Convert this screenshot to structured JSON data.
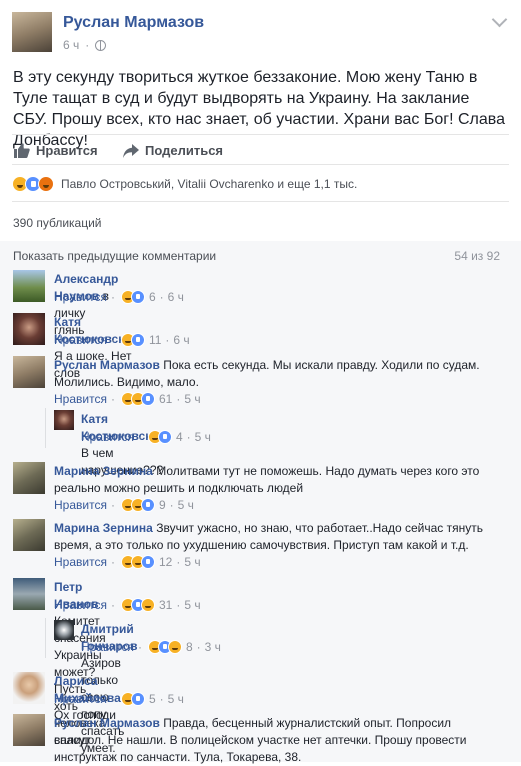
{
  "post": {
    "author": "Руслан Мармазов",
    "time": "6 ч",
    "text": "В эту секунду твориться жуткое беззаконие. Мою жену Таню в Туле тащат в суд и будут выдворять на Украину. На заклание СБУ. Прошу всех, кто нас знает, об участии. Храни вас Бог! Слава Донбассу!",
    "actions": {
      "like": "Нравится",
      "share": "Поделиться"
    },
    "reactions_text": "Павло Островський, Vitalii Ovcharenko и еще 1,1 тыс.",
    "shares": "390 публикаций"
  },
  "comments_header": {
    "prev_label": "Показать предыдущие комментарии",
    "count": "54 из 92"
  },
  "comments": [
    {
      "name": "Александр Наумов",
      "text": "в личку глянь",
      "like": "Нравится",
      "count": "6",
      "time": "6 ч"
    },
    {
      "name": "Катя Костюковская",
      "text": "Я а шоке. Нет слов",
      "like": "Нравится",
      "count": "11",
      "time": "6 ч"
    },
    {
      "name": "Руслан Мармазов",
      "text": "Пока есть секунда. Мы искали правду. Ходили по судам.",
      "text2": "Молились. Видимо, мало.",
      "like": "Нравится",
      "count": "61",
      "time": "5 ч"
    },
    {
      "name": "Катя Костюковская",
      "text": "В чем нарушение???",
      "like": "Нравится",
      "count": "4",
      "time": "5 ч"
    },
    {
      "name": "Марина Зернина",
      "text": "Молитвами тут не поможешь. Надо думать через кого это",
      "text2": "реально можно решить и подключать людей",
      "like": "Нравится",
      "count": "9",
      "time": "5 ч"
    },
    {
      "name": "Марина Зернина",
      "text": "Звучит ужасно, но знаю, что работает..Надо сейчас тянуть",
      "text2": "время, а это только по ухудшению самочувствия. Приступ там какой и т.д.",
      "like": "Нравится",
      "count": "12",
      "time": "5 ч"
    },
    {
      "name": "Петр Иванов",
      "text": "Комитет спасения Украины может? Пусть хоть человека спасут",
      "like": "Нравится",
      "count": "31",
      "time": "5 ч"
    },
    {
      "name": "Дмитрий Гончаров",
      "text": "Азиров только свою попу спасать умеет.",
      "like": "Нравится",
      "count": "8",
      "time": "3 ч"
    },
    {
      "name": "Лариса Михайлова",
      "text": "Ох господи",
      "like": "Нравится",
      "count": "5",
      "time": "5 ч"
    },
    {
      "name": "Руслан Мармазов",
      "text": "Правда, бесценный журналистский опыт. Попросил",
      "text2": "валидол. Не нашли. В полицейском участке нет аптечки. Прошу провести",
      "text3": "инструктаж по санчасти. Тула, Токарева, 38."
    }
  ],
  "colors": {
    "link": "#365899",
    "bg_comments": "#f6f7f9",
    "like_blue": "#5890ff",
    "haha_yellow": "#f7b125",
    "angry_orange": "#e9710f"
  },
  "icons": [
    "globe-icon",
    "chevron-down-icon",
    "thumbs-up-icon",
    "share-arrow-icon",
    "haha-reaction-icon",
    "like-reaction-icon",
    "angry-reaction-icon",
    "wow-reaction-icon",
    "sad-reaction-icon"
  ]
}
